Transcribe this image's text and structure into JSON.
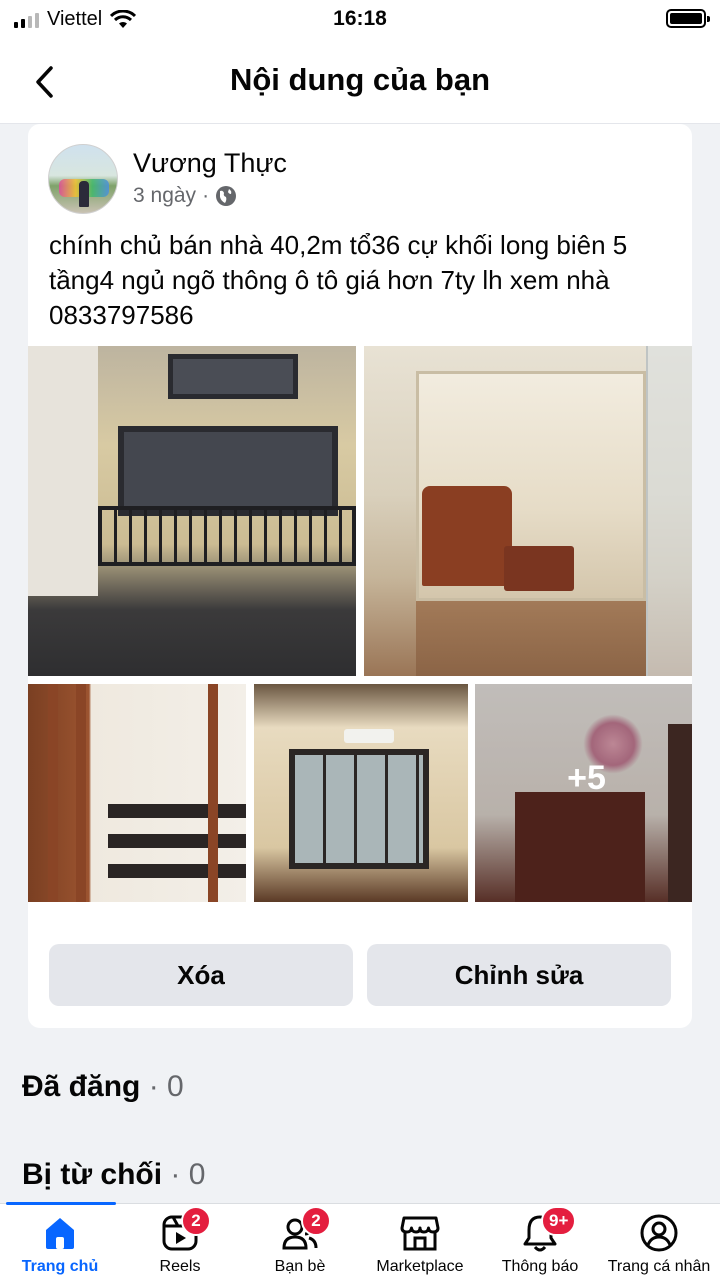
{
  "status_bar": {
    "carrier": "Viettel",
    "time": "16:18"
  },
  "header": {
    "title": "Nội dung của bạn",
    "back_icon": "chevron-left-icon"
  },
  "post": {
    "author": "Vương Thực",
    "time": "3 ngày",
    "separator": "·",
    "privacy_icon": "globe-icon",
    "text": "chính chủ bán nhà 40,2m tổ36 cự khối long biên 5 tầng4 ngủ ngõ thông ô tô giá hơn 7ty lh xem nhà 0833797586",
    "more_photos": "+5",
    "delete_label": "Xóa",
    "edit_label": "Chỉnh sửa"
  },
  "sections": {
    "posted": {
      "label": "Đã đăng",
      "dot": "·",
      "count": "0"
    },
    "rejected": {
      "label": "Bị từ chối",
      "dot": "·",
      "count": "0"
    }
  },
  "tabs": [
    {
      "label": "Trang chủ",
      "icon": "home-icon",
      "active": true
    },
    {
      "label": "Reels",
      "icon": "reels-icon",
      "badge": "2"
    },
    {
      "label": "Bạn bè",
      "icon": "friends-icon",
      "badge": "2"
    },
    {
      "label": "Marketplace",
      "icon": "marketplace-icon"
    },
    {
      "label": "Thông báo",
      "icon": "bell-icon",
      "badge": "9+"
    },
    {
      "label": "Trang cá nhân",
      "icon": "profile-icon"
    }
  ],
  "colors": {
    "accent": "#0866ff",
    "badge": "#e41e3f",
    "secondary_text": "#65676b",
    "button_bg": "#e4e6eb"
  }
}
